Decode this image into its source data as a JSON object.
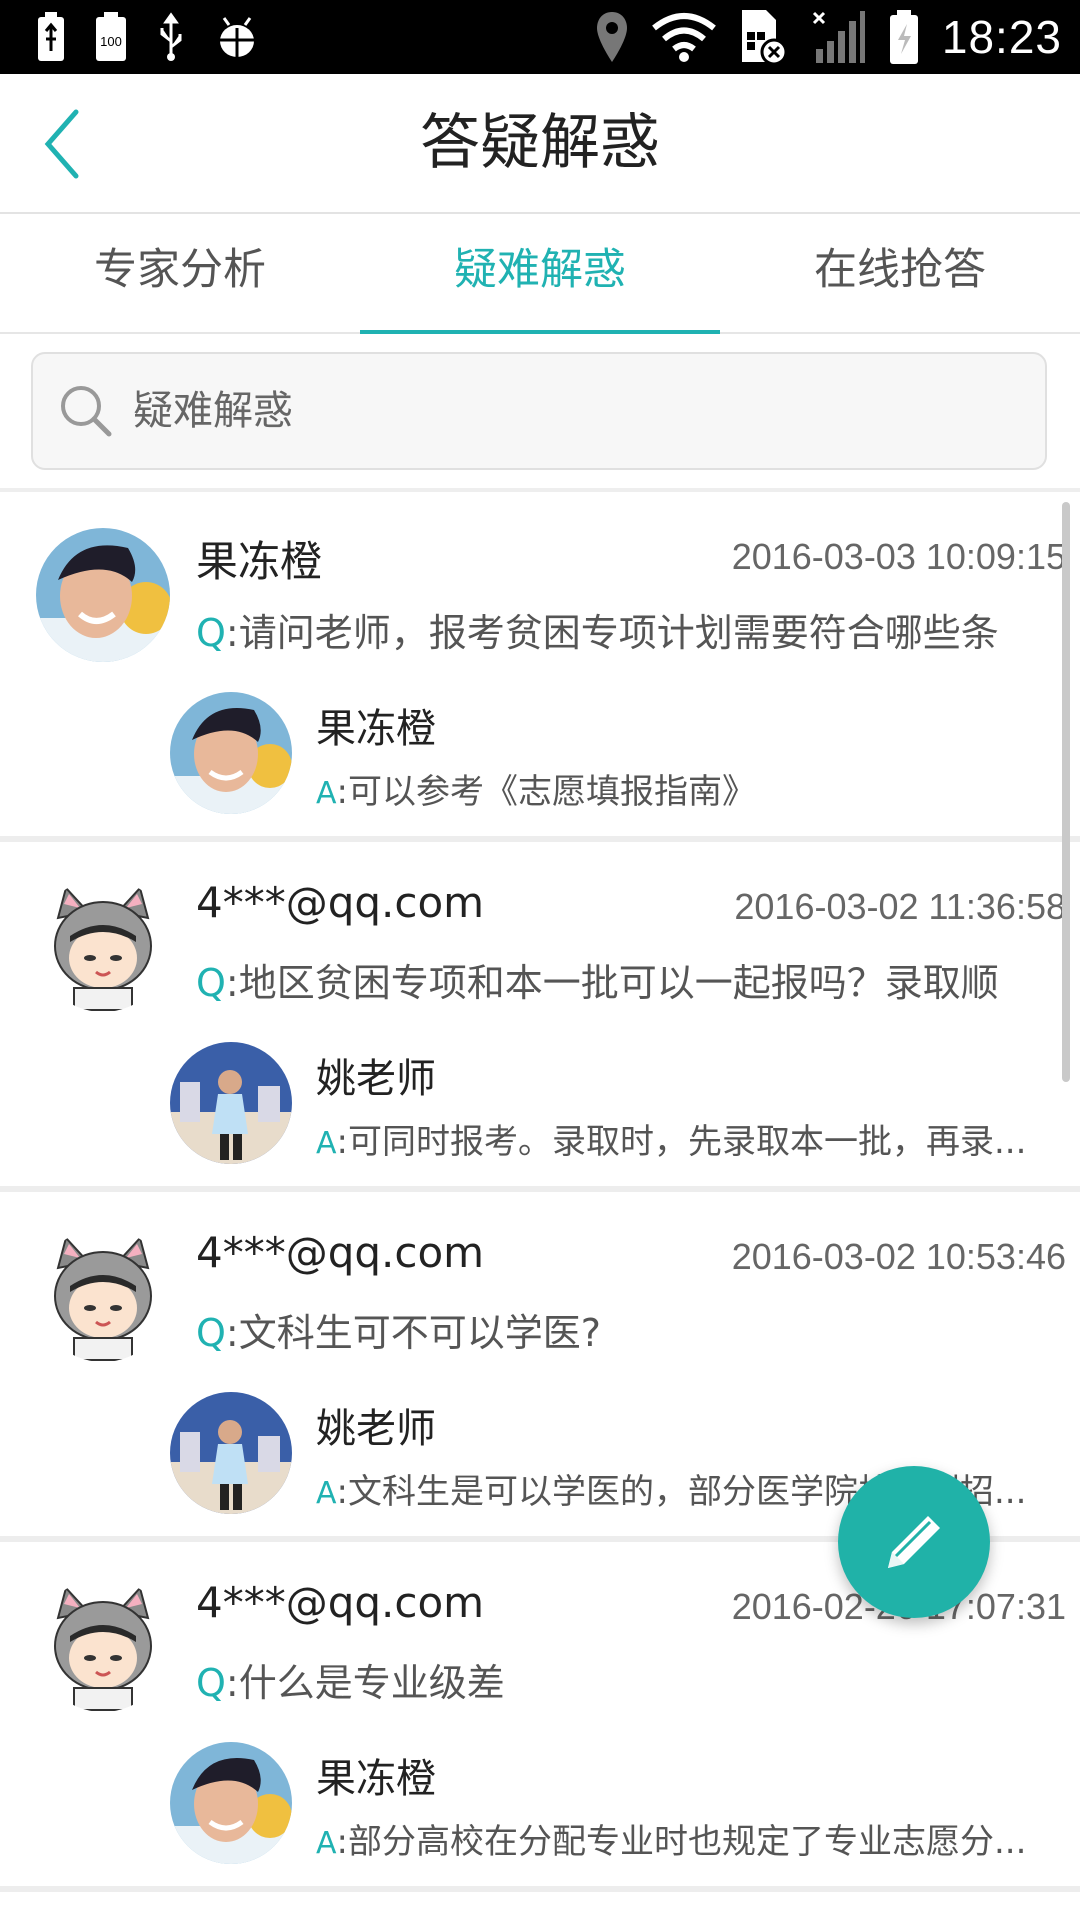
{
  "status_bar": {
    "time": "18:23",
    "left_icons": [
      "battery-usb-icon",
      "battery-100-icon",
      "usb-icon",
      "android-debug-icon"
    ],
    "right_icons": [
      "location-icon",
      "wifi-icon",
      "sim-blocked-icon",
      "signal-icon",
      "battery-charging-icon"
    ],
    "battery_label": "100"
  },
  "header": {
    "title": "答疑解惑",
    "back_icon": "back-chevron-icon"
  },
  "tabs": [
    {
      "label": "专家分析",
      "active": false
    },
    {
      "label": "疑难解惑",
      "active": true
    },
    {
      "label": "在线抢答",
      "active": false
    }
  ],
  "search": {
    "placeholder": "疑难解惑",
    "icon": "search-icon"
  },
  "items": [
    {
      "asker": "果冻橙",
      "time": "2016-03-03 10:09:15",
      "q_prefix": "Q",
      "question": ":请问老师，报考贫困专项计划需要符合哪些条",
      "answerer": "果冻橙",
      "a_prefix": "A",
      "answer": ":可以参考《志愿填报指南》"
    },
    {
      "asker": "4***@qq.com",
      "time": "2016-03-02 11:36:58",
      "q_prefix": "Q",
      "question": ":地区贫困专项和本一批可以一起报吗？录取顺",
      "answerer": "姚老师",
      "a_prefix": "A",
      "answer": ":可同时报考。录取时，先录取本一批，再录..."
    },
    {
      "asker": "4***@qq.com",
      "time": "2016-03-02 10:53:46",
      "q_prefix": "Q",
      "question": ":文科生可不可以学医?",
      "answerer": "姚老师",
      "a_prefix": "A",
      "answer": ":文科生是可以学医的，部分医学院校计划招..."
    },
    {
      "asker": "4***@qq.com",
      "time": "2016-02-26 17:07:31",
      "q_prefix": "Q",
      "question": ":什么是专业级差",
      "answerer": "果冻橙",
      "a_prefix": "A",
      "answer": ":部分高校在分配专业时也规定了专业志愿分..."
    }
  ],
  "fab": {
    "icon": "pencil-icon"
  },
  "colors": {
    "accent": "#20b2b2",
    "fab": "#20b2a8"
  }
}
